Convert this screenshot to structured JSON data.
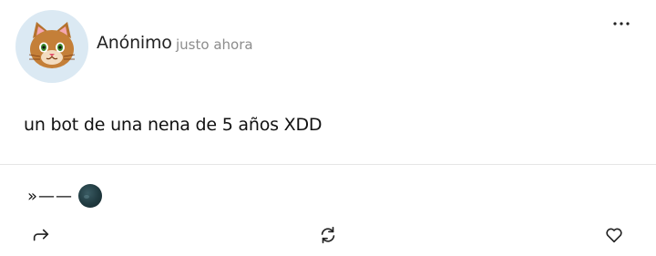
{
  "post": {
    "author": "Anónimo",
    "timestamp": "justo ahora",
    "text": "un bot de una nena de 5 años XDD"
  },
  "signature": {
    "text": "»——"
  },
  "icons": {
    "avatar": "cat-avatar",
    "more": "more-dots-icon",
    "moon": "new-moon-emoji",
    "share": "share-arrow-icon",
    "repost": "repost-icon",
    "like": "heart-icon"
  },
  "colors": {
    "avatar_bg": "#dbe9f3",
    "text": "#111111",
    "timestamp": "#8c8c8c"
  }
}
